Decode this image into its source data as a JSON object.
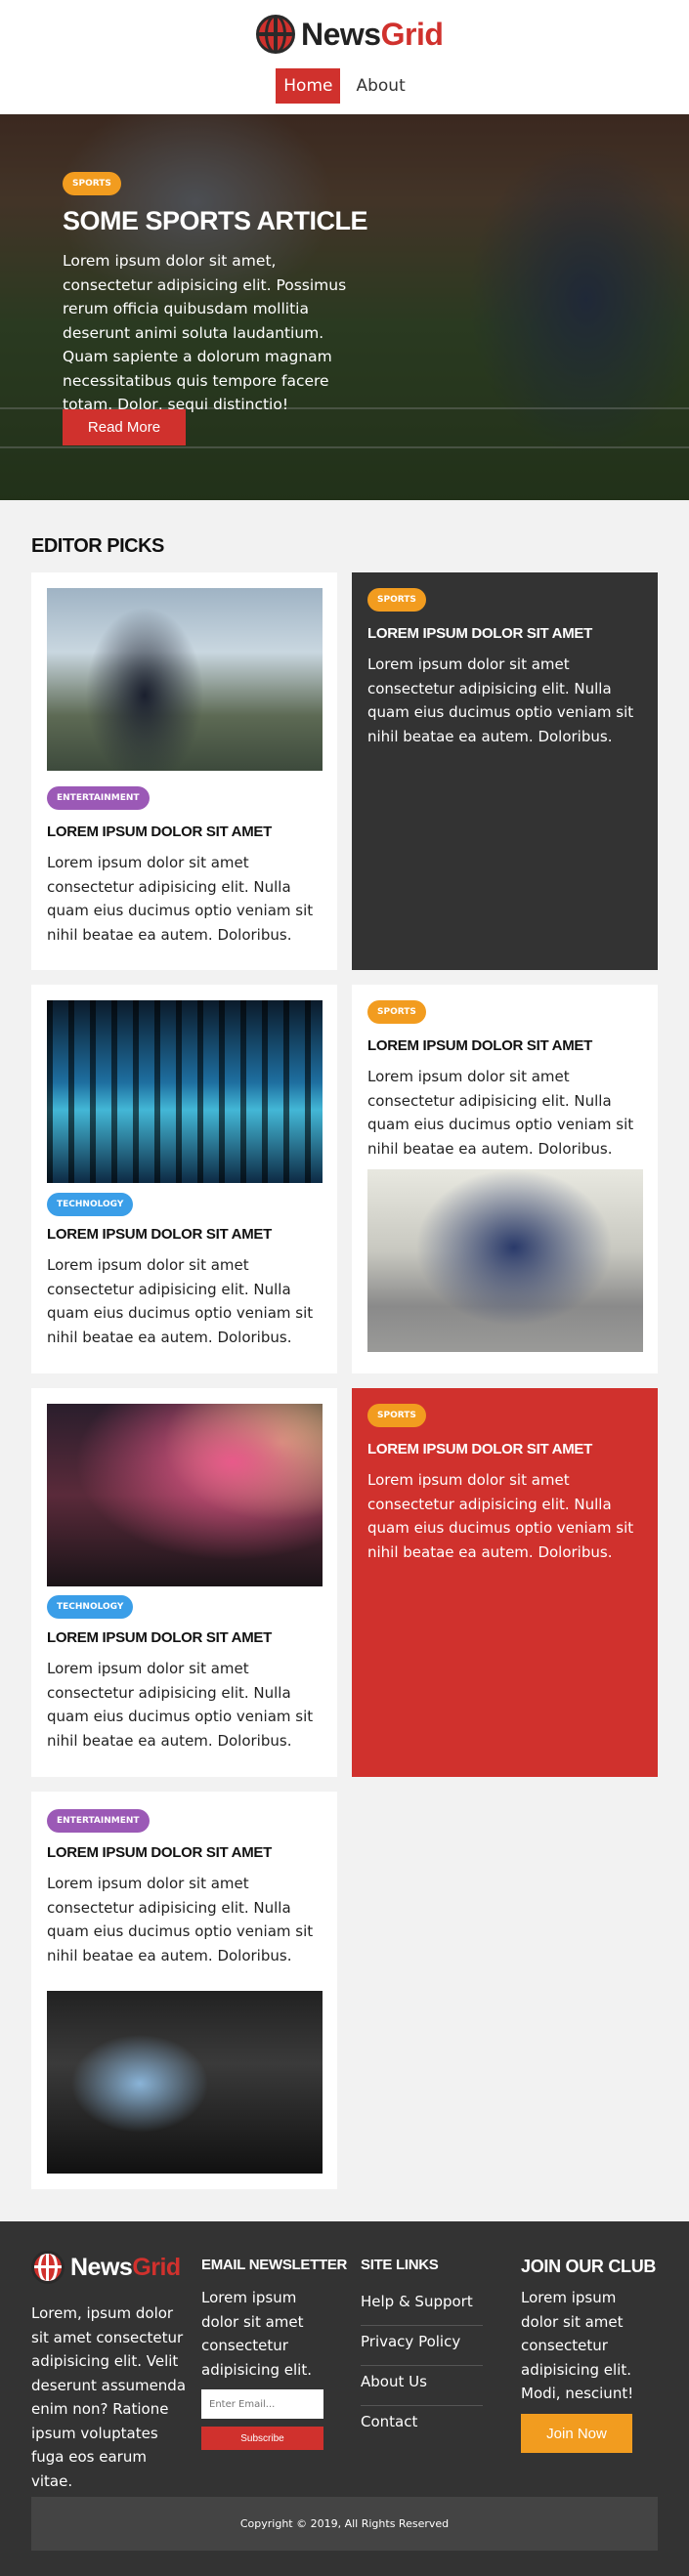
{
  "header": {
    "logo_main": "News",
    "logo_accent": "Grid",
    "nav": [
      {
        "label": "Home",
        "active": true
      },
      {
        "label": "About",
        "active": false
      }
    ]
  },
  "hero": {
    "tag": "SPORTS",
    "title": "SOME SPORTS ARTICLE",
    "text": "Lorem ipsum dolor sit amet, consectetur adipisicing elit. Possimus rerum officia quibusdam mollitia deserunt animi soluta laudantium. Quam sapiente a dolorum magnam necessitatibus quis tempore facere totam. Dolor, sequi distinctio!",
    "button": "Read More"
  },
  "editor_picks": {
    "heading": "EDITOR PICKS",
    "cards": [
      {
        "tag": "ENTERTAINMENT",
        "title": "LOREM IPSUM DOLOR SIT AMET",
        "text": "Lorem ipsum dolor sit amet consectetur adipisicing elit. Nulla quam eius ducimus optio veniam sit nihil beatae ea autem. Doloribus.",
        "image": "vr-headset-photo"
      },
      {
        "tag": "SPORTS",
        "title": "LOREM IPSUM DOLOR SIT AMET",
        "text": "Lorem ipsum dolor sit amet consectetur adipisicing elit. Nulla quam eius ducimus optio veniam sit nihil beatae ea autem. Doloribus."
      },
      {
        "tag": "TECHNOLOGY",
        "title": "LOREM IPSUM DOLOR SIT AMET",
        "text": "Lorem ipsum dolor sit amet consectetur adipisicing elit. Nulla quam eius ducimus optio veniam sit nihil beatae ea autem. Doloribus.",
        "image": "server-rack-photo"
      },
      {
        "tag": "SPORTS",
        "title": "LOREM IPSUM DOLOR SIT AMET",
        "text": "Lorem ipsum dolor sit amet consectetur adipisicing elit. Nulla quam eius ducimus optio veniam sit nihil beatae ea autem. Doloribus.",
        "image": "cyclists-photo"
      },
      {
        "tag": "TECHNOLOGY",
        "title": "LOREM IPSUM DOLOR SIT AMET",
        "text": "Lorem ipsum dolor sit amet consectetur adipisicing elit. Nulla quam eius ducimus optio veniam sit nihil beatae ea autem. Doloribus.",
        "image": "laptop-keyboard-photo"
      },
      {
        "tag": "SPORTS",
        "title": "LOREM IPSUM DOLOR SIT AMET",
        "text": "Lorem ipsum dolor sit amet consectetur adipisicing elit. Nulla quam eius ducimus optio veniam sit nihil beatae ea autem. Doloribus."
      },
      {
        "tag": "ENTERTAINMENT",
        "title": "LOREM IPSUM DOLOR SIT AMET",
        "text": "Lorem ipsum dolor sit amet consectetur adipisicing elit. Nulla quam eius ducimus optio veniam sit nihil beatae ea autem. Doloribus.",
        "image": "video-camera-photo"
      }
    ]
  },
  "footer": {
    "logo_main": "News",
    "logo_accent": "Grid",
    "about": "Lorem, ipsum dolor sit amet consectetur adipisicing elit. Velit deserunt assumenda enim non? Ratione ipsum voluptates fuga eos earum vitae.",
    "newsletter": {
      "heading": "EMAIL NEWSLETTER",
      "text": "Lorem ipsum dolor sit amet consectetur adipisicing elit.",
      "placeholder": "Enter Email...",
      "button": "Subscribe"
    },
    "site_links": {
      "heading": "SITE LINKS",
      "links": [
        "Help & Support",
        "Privacy Policy",
        "About Us",
        "Contact"
      ]
    },
    "club": {
      "heading": "JOIN OUR CLUB",
      "text": "Lorem ipsum dolor sit amet consectetur adipisicing elit. Modi, nesciunt!",
      "button": "Join Now"
    },
    "copyright": "Copyright © 2019, All Rights Reserved"
  },
  "colors": {
    "brand_red": "#d0312d",
    "sports_orange": "#f29c1f",
    "entertainment_purple": "#9b59b6",
    "technology_blue": "#3a9ee8",
    "dark_card": "#333333"
  }
}
